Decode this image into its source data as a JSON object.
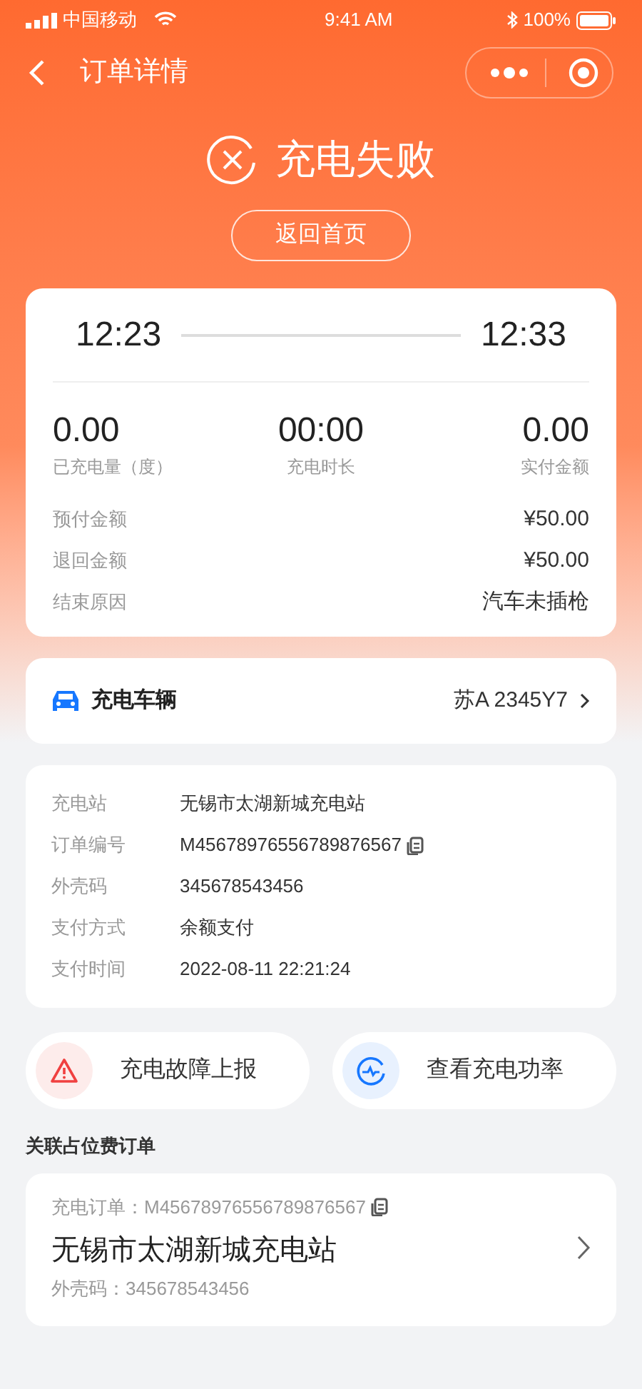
{
  "status_bar": {
    "carrier": "中国移动",
    "time": "9:41 AM",
    "battery": "100%"
  },
  "nav": {
    "title": "订单详情"
  },
  "result": {
    "title": "充电失败",
    "button": "返回首页"
  },
  "times": {
    "start": "12:23",
    "end": "12:33"
  },
  "stats": [
    {
      "value": "0.00",
      "label": "已充电量（度）"
    },
    {
      "value": "00:00",
      "label": "充电时长"
    },
    {
      "value": "0.00",
      "label": "实付金额"
    }
  ],
  "amounts": [
    {
      "label": "预付金额",
      "value": "¥50.00"
    },
    {
      "label": "退回金额",
      "value": "¥50.00"
    },
    {
      "label": "结束原因",
      "value": "汽车未插枪"
    }
  ],
  "vehicle": {
    "label": "充电车辆",
    "plate": "苏A 2345Y7"
  },
  "details": [
    {
      "label": "充电站",
      "value": "无锡市太湖新城充电站",
      "copy": false
    },
    {
      "label": "订单编号",
      "value": "M45678976556789876567",
      "copy": true
    },
    {
      "label": "外壳码",
      "value": "345678543456",
      "copy": false
    },
    {
      "label": "支付方式",
      "value": "余额支付",
      "copy": false
    },
    {
      "label": "支付时间",
      "value": "2022-08-11 22:21:24",
      "copy": false
    }
  ],
  "actions": [
    {
      "kind": "fault",
      "label": "充电故障上报"
    },
    {
      "kind": "power",
      "label": "查看充电功率"
    }
  ],
  "related": {
    "title": "关联占位费订单",
    "order": "充电订单：M45678976556789876567",
    "station": "无锡市太湖新城充电站",
    "code": "外壳码：345678543456"
  }
}
